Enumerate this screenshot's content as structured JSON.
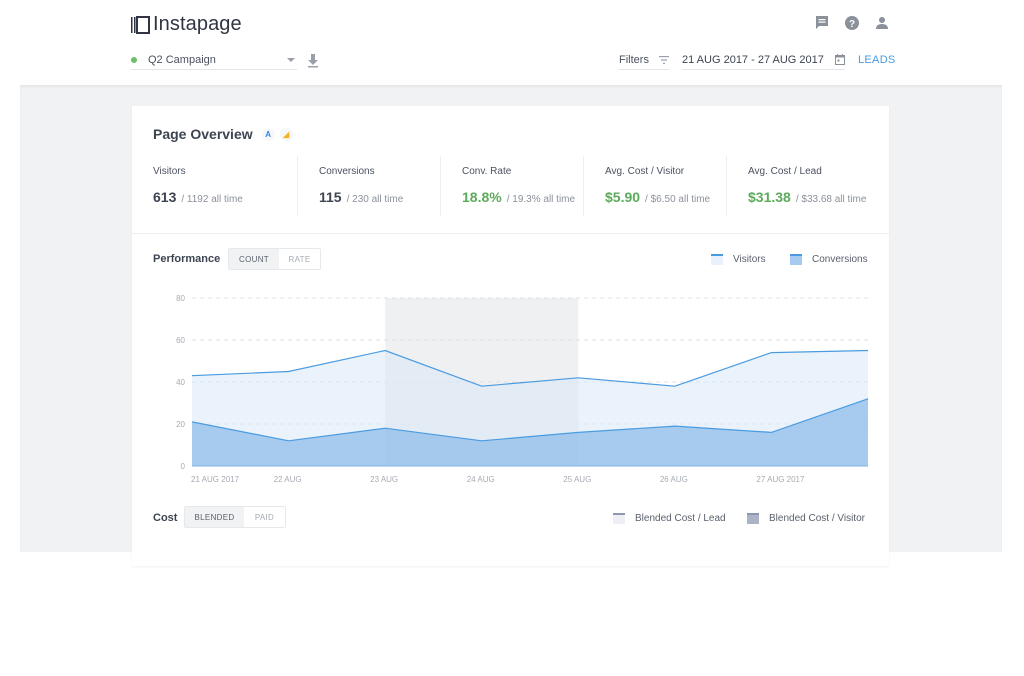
{
  "app": {
    "brand": "Instapage",
    "header_icons": [
      "chat-icon",
      "help-icon",
      "account-icon"
    ]
  },
  "toolbar": {
    "campaign": {
      "name": "Q2 Campaign",
      "status_color": "#6abf69"
    },
    "download_icon": "download-icon",
    "filters_label": "Filters",
    "date_range": "21 AUG 2017 - 27 AUG 2017",
    "leads_label": "LEADS"
  },
  "overview": {
    "title": "Page Overview",
    "badges": [
      "A",
      "◢"
    ],
    "stats": [
      {
        "label": "Visitors",
        "value": "613",
        "sub": "/ 1192 all time",
        "highlight": false
      },
      {
        "label": "Conversions",
        "value": "115",
        "sub": "/ 230 all time",
        "highlight": false
      },
      {
        "label": "Conv. Rate",
        "value": "18.8%",
        "sub": "/ 19.3% all time",
        "highlight": true
      },
      {
        "label": "Avg. Cost / Visitor",
        "value": "$5.90",
        "sub": "/ $6.50 all time",
        "highlight": true
      },
      {
        "label": "Avg. Cost / Lead",
        "value": "$31.38",
        "sub": "/ $33.68 all time",
        "highlight": true
      }
    ]
  },
  "performance": {
    "title": "Performance",
    "toggle": {
      "active": "COUNT",
      "inactive": "RATE"
    },
    "legend": [
      {
        "label": "Visitors",
        "color": "#e8f1fc",
        "stroke": "#4a9be0"
      },
      {
        "label": "Conversions",
        "color": "#a6cbf0",
        "stroke": "#4a9be0"
      }
    ]
  },
  "cost": {
    "title": "Cost",
    "toggle": {
      "active": "BLENDED",
      "inactive": "PAID"
    },
    "legend": [
      {
        "label": "Blended Cost / Lead",
        "color": "#eeeff4"
      },
      {
        "label": "Blended Cost / Visitor",
        "color": "#aab4c6"
      }
    ]
  },
  "chart_data": {
    "type": "area",
    "title": "Performance",
    "x": [
      "21 AUG 2017",
      "22 AUG",
      "23 AUG",
      "24 AUG",
      "25 AUG",
      "26 AUG",
      "27 AUG 2017",
      ""
    ],
    "tick_labels": [
      "21 AUG 2017",
      "22 AUG",
      "23 AUG",
      "24 AUG",
      "25 AUG",
      "26 AUG",
      "27 AUG 2017"
    ],
    "series": [
      {
        "name": "Visitors",
        "values": [
          43,
          45,
          55,
          38,
          42,
          38,
          54,
          55
        ]
      },
      {
        "name": "Conversions",
        "values": [
          21,
          12,
          18,
          12,
          16,
          19,
          16,
          32
        ]
      }
    ],
    "highlight_range": [
      "23 AUG",
      "25 AUG"
    ],
    "ylim": [
      0,
      80
    ],
    "yticks": [
      0,
      20,
      40,
      60,
      80
    ],
    "grid": true,
    "legend_position": "top-right",
    "xlabel": "",
    "ylabel": ""
  }
}
